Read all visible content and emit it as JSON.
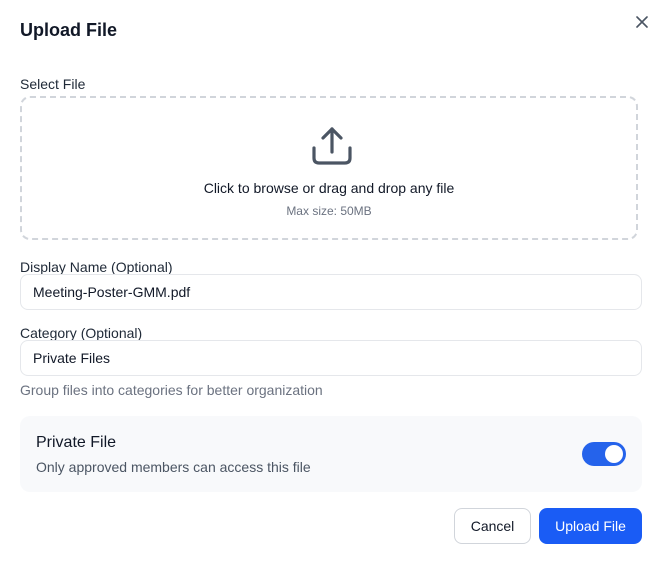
{
  "dialog": {
    "title": "Upload File",
    "close_icon": "close-icon"
  },
  "select_file": {
    "label": "Select File",
    "icon": "upload-icon",
    "prompt": "Click to browse or drag and drop any file",
    "max_size": "Max size: 50MB"
  },
  "display_name": {
    "label": "Display Name (Optional)",
    "value": "Meeting-Poster-GMM.pdf"
  },
  "category": {
    "label": "Category (Optional)",
    "value": "Private Files",
    "helper": "Group files into categories for better organization"
  },
  "private_file": {
    "title": "Private File",
    "description": "Only approved members can access this file",
    "enabled": true
  },
  "actions": {
    "cancel_label": "Cancel",
    "upload_label": "Upload File"
  },
  "colors": {
    "primary": "#1a5cf5",
    "toggle_on": "#2563eb",
    "muted_text": "#6b7280",
    "card_bg": "#f8f9fb"
  }
}
